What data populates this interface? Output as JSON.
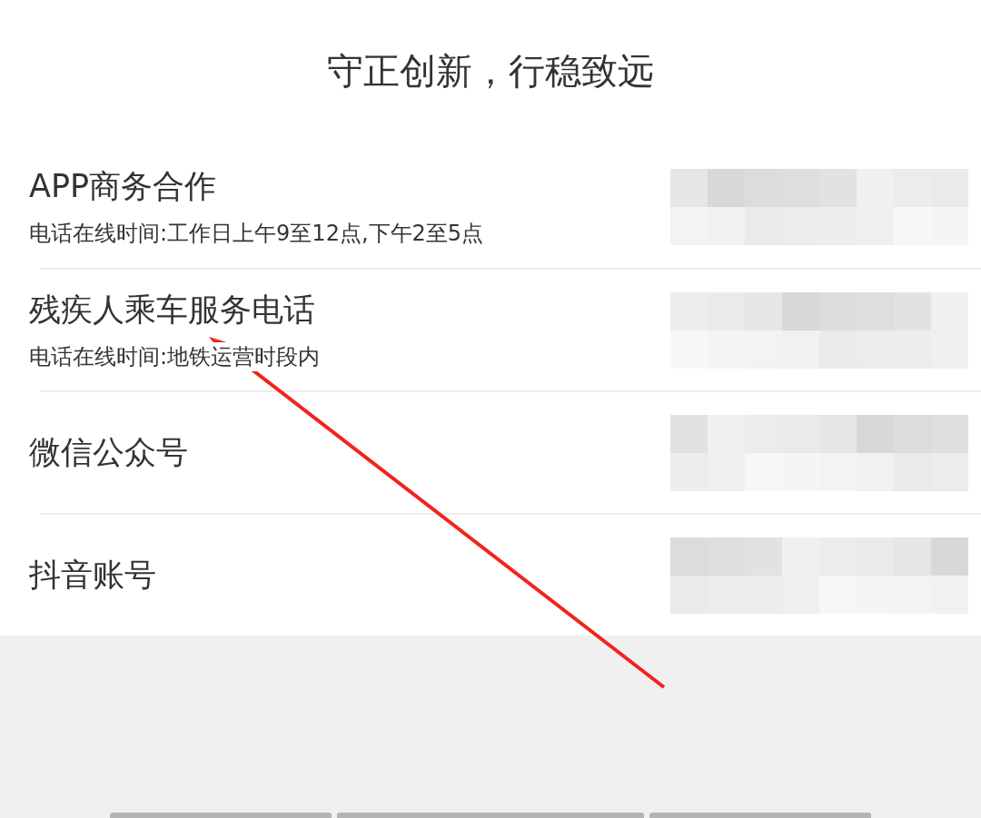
{
  "header": {
    "title": "守正创新，行稳致远"
  },
  "contacts": [
    {
      "name": "APP商务合作",
      "note": "电话在线时间:工作日上午9至12点,下午2至5点"
    },
    {
      "name": "残疾人乘车服务电话",
      "note": "电话在线时间:地铁运营时段内"
    },
    {
      "name": "微信公众号"
    },
    {
      "name": "抖音账号"
    }
  ]
}
